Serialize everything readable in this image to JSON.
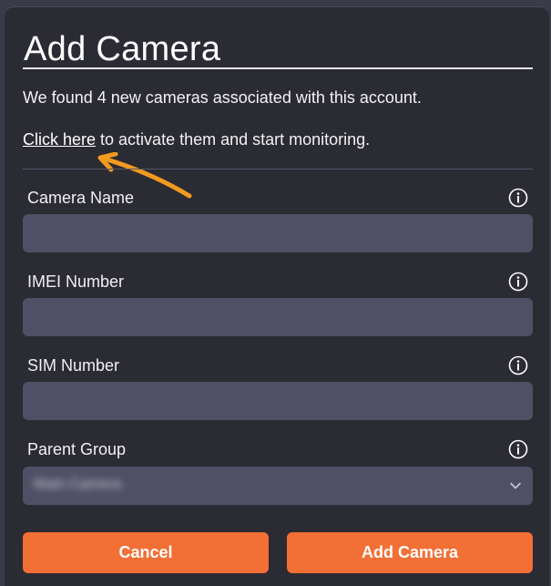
{
  "dialog": {
    "title": "Add Camera",
    "intro_text": "We found 4 new cameras associated with this account.",
    "activate_link": "Click here",
    "activate_rest": " to activate them and start monitoring."
  },
  "fields": {
    "camera_name": {
      "label": "Camera Name",
      "value": "",
      "info_icon": "info-icon"
    },
    "imei_number": {
      "label": "IMEI Number",
      "value": "",
      "info_icon": "info-icon"
    },
    "sim_number": {
      "label": "SIM Number",
      "value": "",
      "info_icon": "info-icon"
    },
    "parent_group": {
      "label": "Parent Group",
      "selected": "Main Camera",
      "info_icon": "info-icon"
    }
  },
  "buttons": {
    "cancel": "Cancel",
    "add_camera": "Add Camera"
  },
  "colors": {
    "background": "#2b2b33",
    "input": "#4f5065",
    "accent": "#f26f35",
    "annotation_arrow": "#f29a1f"
  }
}
